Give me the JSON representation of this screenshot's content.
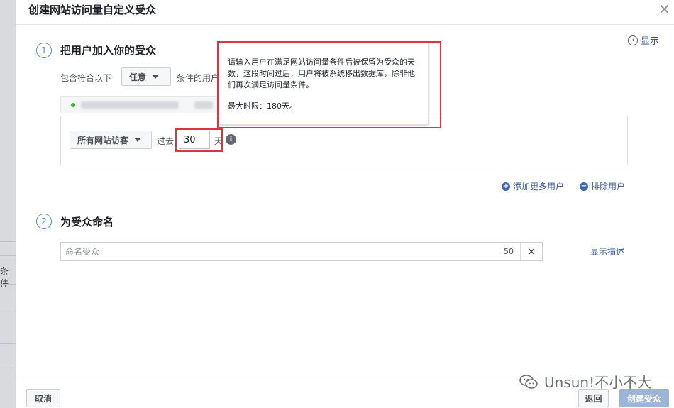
{
  "dialog": {
    "title": "创建网站访问量自定义受众",
    "show_link": "显示"
  },
  "background": {
    "fragment": "条件"
  },
  "section1": {
    "number": "1",
    "title": "把用户加入你的受众",
    "include_text": "包含符合以下",
    "any_dropdown": "任意",
    "conditions_text": "条件的用户",
    "rule": {
      "audience_type": "所有网站访客",
      "past_label": "过去",
      "days_value": "30",
      "days_unit": "天",
      "info_icon": "info-icon"
    },
    "tooltip": {
      "line1": "请输入用户在满足网站访问量条件后被保留为受众的天数，这段时间过后，用户将被系统移出数据库，除非他们再次满足访问量条件。",
      "line2": "最大时限：180天。"
    },
    "add_more": "添加更多用户",
    "exclude": "排除用户"
  },
  "section2": {
    "number": "2",
    "title": "为受众命名",
    "name_placeholder": "命名受众",
    "char_count": "50",
    "show_description": "显示描述"
  },
  "footer": {
    "cancel": "取消",
    "back": "返回",
    "create": "创建受众"
  },
  "watermark": {
    "text": "Unsun!不小不大"
  },
  "colors": {
    "link": "#365899",
    "step_circle": "#4a90e2",
    "highlight_box": "#d9363e",
    "primary_disabled": "#9cb4d8"
  }
}
